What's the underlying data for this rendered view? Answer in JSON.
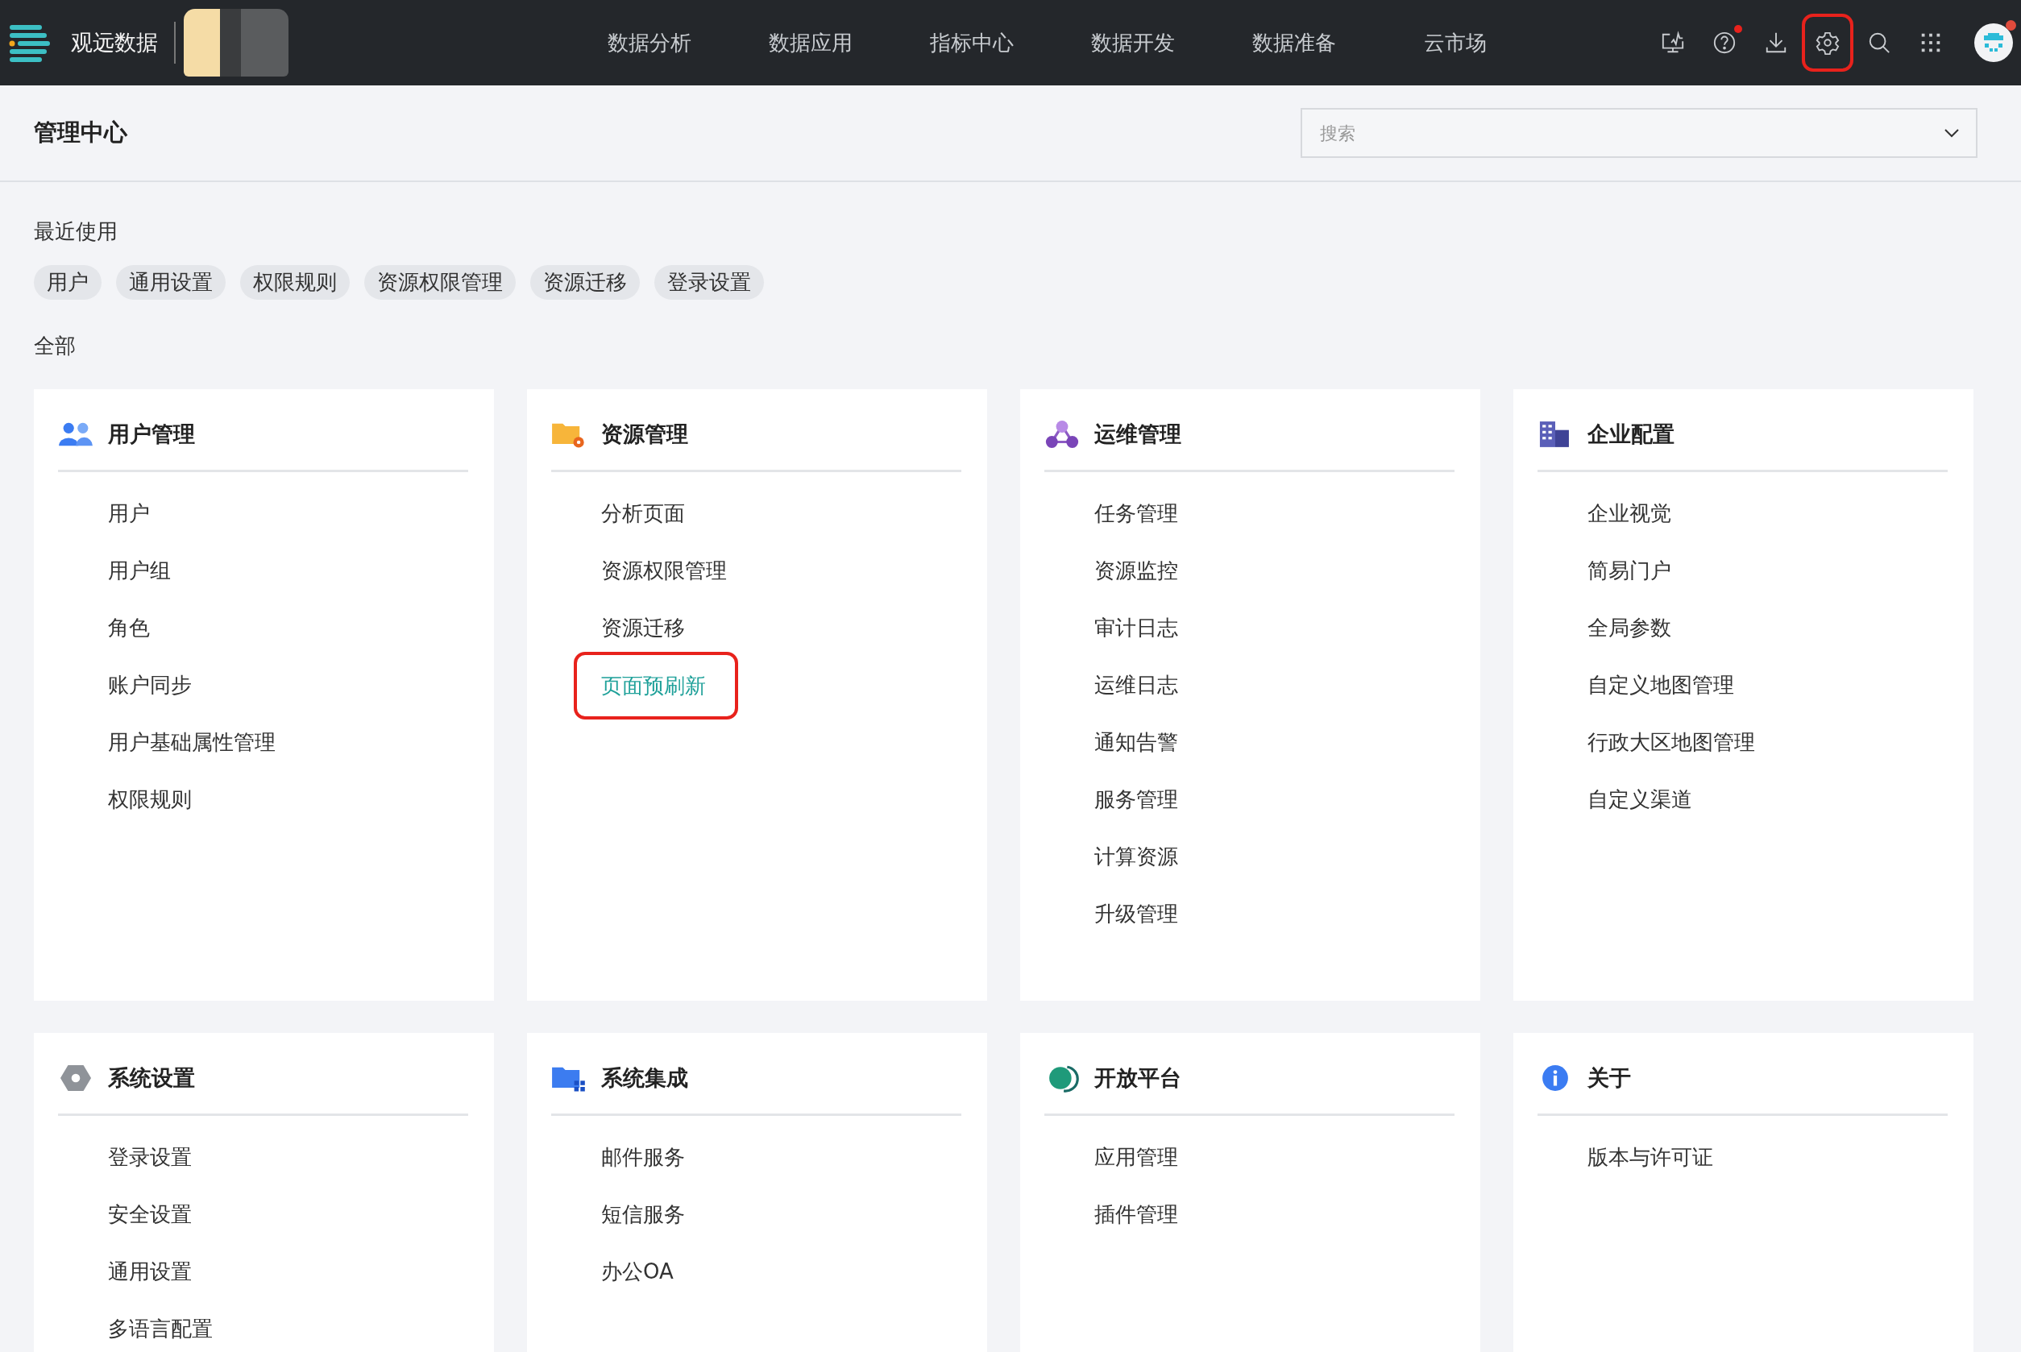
{
  "top_bar": {
    "brand": "观远数据",
    "nav": [
      {
        "label": "数据分析",
        "selected": false
      },
      {
        "label": "数据应用",
        "selected": false
      },
      {
        "label": "指标中心",
        "selected": false
      },
      {
        "label": "数据开发",
        "selected": false
      },
      {
        "label": "数据准备",
        "selected": false
      },
      {
        "label": "云市场",
        "selected": false
      }
    ],
    "icons": [
      {
        "kind": "monitor",
        "badge": false,
        "highlighted": false
      },
      {
        "kind": "help",
        "badge": true,
        "highlighted": false
      },
      {
        "kind": "download",
        "badge": false,
        "highlighted": false
      },
      {
        "kind": "settings",
        "badge": false,
        "highlighted": true
      },
      {
        "kind": "search",
        "badge": false,
        "highlighted": false
      },
      {
        "kind": "apps",
        "badge": false,
        "highlighted": false
      }
    ],
    "avatar_badge": true
  },
  "header": {
    "title": "管理中心",
    "search": {
      "placeholder": "搜索"
    }
  },
  "recent": {
    "title": "最近使用",
    "chips": [
      "用户",
      "通用设置",
      "权限规则",
      "资源权限管理",
      "资源迁移",
      "登录设置"
    ]
  },
  "all_title": "全部",
  "cards": [
    {
      "kind": "users",
      "title": "用户管理",
      "items": [
        {
          "label": "用户",
          "highlighted": false
        },
        {
          "label": "用户组",
          "highlighted": false
        },
        {
          "label": "角色",
          "highlighted": false
        },
        {
          "label": "账户同步",
          "highlighted": false
        },
        {
          "label": "用户基础属性管理",
          "highlighted": false
        },
        {
          "label": "权限规则",
          "highlighted": false
        }
      ]
    },
    {
      "kind": "folder-gear",
      "title": "资源管理",
      "items": [
        {
          "label": "分析页面",
          "highlighted": false
        },
        {
          "label": "资源权限管理",
          "highlighted": false
        },
        {
          "label": "资源迁移",
          "highlighted": false
        },
        {
          "label": "页面预刷新",
          "highlighted": true
        }
      ]
    },
    {
      "kind": "nodes",
      "title": "运维管理",
      "items": [
        {
          "label": "任务管理",
          "highlighted": false
        },
        {
          "label": "资源监控",
          "highlighted": false
        },
        {
          "label": "审计日志",
          "highlighted": false
        },
        {
          "label": "运维日志",
          "highlighted": false
        },
        {
          "label": "通知告警",
          "highlighted": false
        },
        {
          "label": "服务管理",
          "highlighted": false
        },
        {
          "label": "计算资源",
          "highlighted": false
        },
        {
          "label": "升级管理",
          "highlighted": false
        }
      ]
    },
    {
      "kind": "building",
      "title": "企业配置",
      "items": [
        {
          "label": "企业视觉",
          "highlighted": false
        },
        {
          "label": "简易门户",
          "highlighted": false
        },
        {
          "label": "全局参数",
          "highlighted": false
        },
        {
          "label": "自定义地图管理",
          "highlighted": false
        },
        {
          "label": "行政大区地图管理",
          "highlighted": false
        },
        {
          "label": "自定义渠道",
          "highlighted": false
        }
      ]
    },
    {
      "kind": "hexagon",
      "title": "系统设置",
      "items": [
        {
          "label": "登录设置",
          "highlighted": false
        },
        {
          "label": "安全设置",
          "highlighted": false
        },
        {
          "label": "通用设置",
          "highlighted": false
        },
        {
          "label": "多语言配置",
          "highlighted": false
        }
      ]
    },
    {
      "kind": "folder-grid",
      "title": "系统集成",
      "items": [
        {
          "label": "邮件服务",
          "highlighted": false
        },
        {
          "label": "短信服务",
          "highlighted": false
        },
        {
          "label": "办公OA",
          "highlighted": false
        }
      ]
    },
    {
      "kind": "globe",
      "title": "开放平台",
      "items": [
        {
          "label": "应用管理",
          "highlighted": false
        },
        {
          "label": "插件管理",
          "highlighted": false
        }
      ]
    },
    {
      "kind": "info",
      "title": "关于",
      "items": [
        {
          "label": "版本与许可证",
          "highlighted": false
        }
      ]
    }
  ]
}
